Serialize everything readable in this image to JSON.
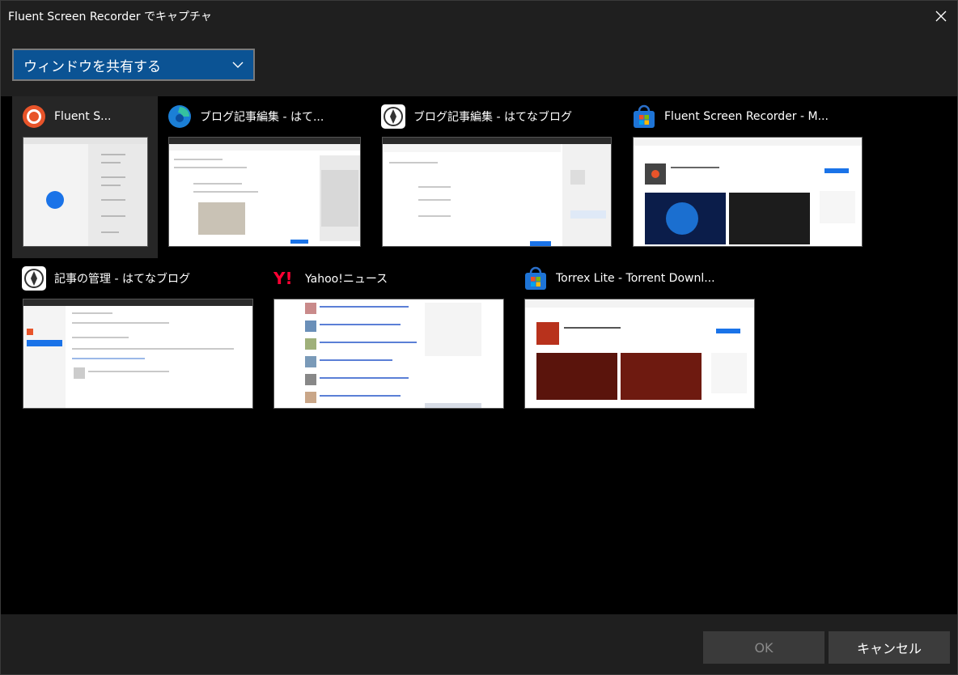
{
  "window": {
    "title": "Fluent Screen Recorder でキャプチャ",
    "close_icon": "close-icon"
  },
  "source_select": {
    "selected": "ウィンドウを共有する",
    "icon": "chevron-down-icon"
  },
  "windows": [
    {
      "title": "Fluent S...",
      "icon": "fluent-recorder-icon",
      "selected": true
    },
    {
      "title": "ブログ記事編集 - はて...",
      "icon": "edge-icon",
      "selected": false
    },
    {
      "title": "ブログ記事編集 - はてなブログ",
      "icon": "hatena-blog-icon",
      "selected": false
    },
    {
      "title": "Fluent Screen Recorder - M...",
      "icon": "microsoft-store-icon",
      "selected": false
    },
    {
      "title": "記事の管理 - はてなブログ",
      "icon": "hatena-blog-icon",
      "selected": false
    },
    {
      "title": "Yahoo!ニュース",
      "icon": "yahoo-icon",
      "selected": false
    },
    {
      "title": "Torrex Lite - Torrent Downl...",
      "icon": "microsoft-store-icon",
      "selected": false
    }
  ],
  "footer": {
    "ok_label": "OK",
    "cancel_label": "キャンセル"
  },
  "colors": {
    "accent": "#0b5394",
    "background": "#000000",
    "panel": "#1f1f1f"
  }
}
